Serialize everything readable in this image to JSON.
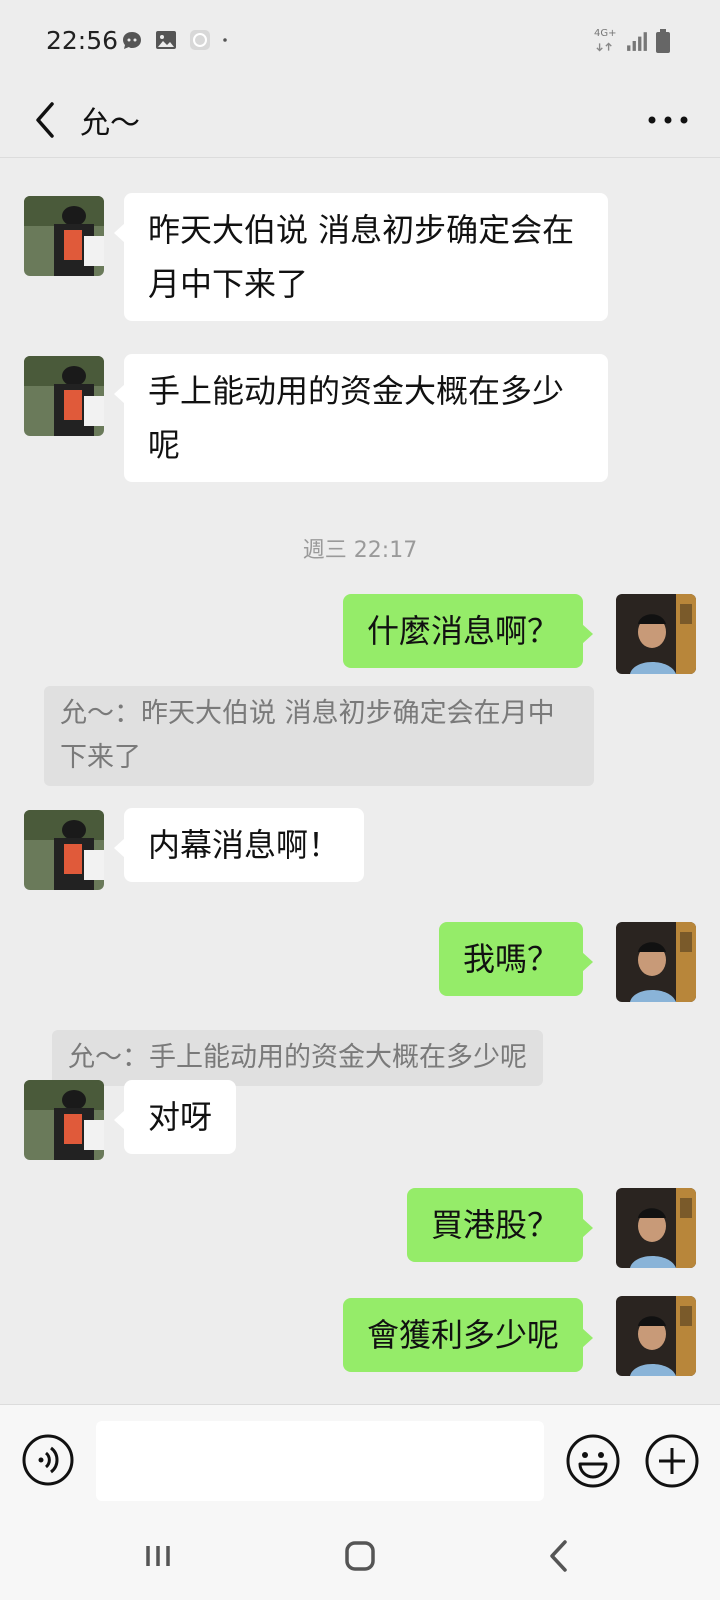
{
  "status_bar": {
    "time": "22:56",
    "icons": [
      "chat-bubble-icon",
      "image-icon",
      "app-icon",
      "dot-icon"
    ],
    "network": "4G+"
  },
  "header": {
    "title": "允～",
    "back_icon": "chevron-left-icon",
    "more_icon": "more-horizontal-icon"
  },
  "colors": {
    "background": "#ededed",
    "incoming_bubble": "#ffffff",
    "outgoing_bubble": "#95ec69",
    "quote_background": "#e0e0e0"
  },
  "messages": [
    {
      "from": "other",
      "text": "昨天大伯说  消息初步确定会在月中下来了"
    },
    {
      "from": "other",
      "text": "手上能动用的资金大概在多少呢"
    },
    {
      "type": "timestamp",
      "text": "週三 22:17"
    },
    {
      "from": "me",
      "text": "什麼消息啊？"
    },
    {
      "type": "quote",
      "text": "允～：昨天大伯说  消息初步确定会在月中下来了"
    },
    {
      "from": "other",
      "text": "内幕消息啊！"
    },
    {
      "from": "me",
      "text": "我嗎？"
    },
    {
      "type": "quote",
      "text": "允～：手上能动用的资金大概在多少呢"
    },
    {
      "from": "other",
      "text": "对呀"
    },
    {
      "from": "me",
      "text": "買港股？"
    },
    {
      "from": "me",
      "text": "會獲利多少呢"
    }
  ],
  "input_bar": {
    "value": "",
    "voice_icon": "voice-icon",
    "emoji_icon": "emoji-icon",
    "plus_icon": "plus-icon"
  },
  "nav_bar": {
    "icons": [
      "recent-apps-icon",
      "home-icon",
      "back-icon"
    ]
  }
}
